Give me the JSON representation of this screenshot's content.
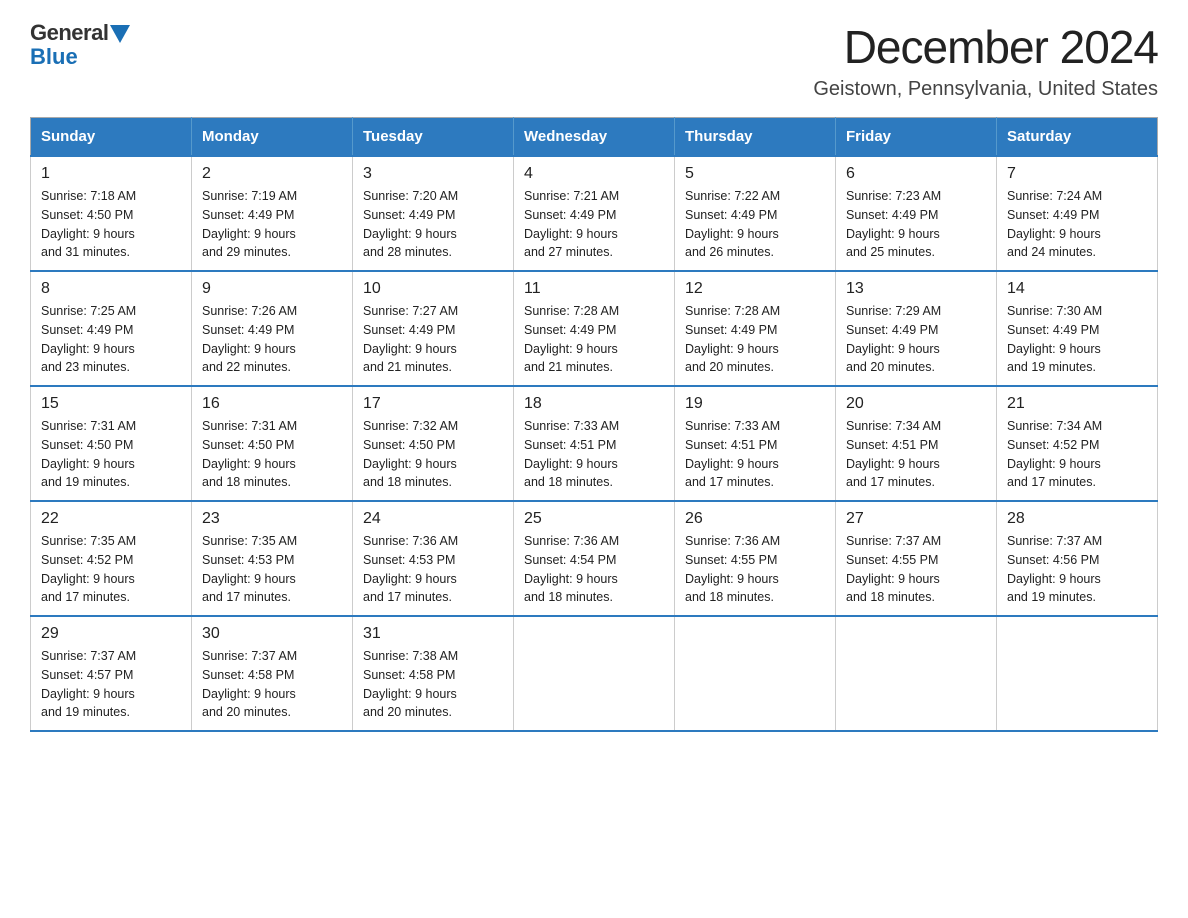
{
  "logo": {
    "general": "General",
    "blue": "Blue"
  },
  "title": "December 2024",
  "subtitle": "Geistown, Pennsylvania, United States",
  "headers": [
    "Sunday",
    "Monday",
    "Tuesday",
    "Wednesday",
    "Thursday",
    "Friday",
    "Saturday"
  ],
  "weeks": [
    [
      {
        "day": "1",
        "sunrise": "7:18 AM",
        "sunset": "4:50 PM",
        "daylight": "9 hours and 31 minutes."
      },
      {
        "day": "2",
        "sunrise": "7:19 AM",
        "sunset": "4:49 PM",
        "daylight": "9 hours and 29 minutes."
      },
      {
        "day": "3",
        "sunrise": "7:20 AM",
        "sunset": "4:49 PM",
        "daylight": "9 hours and 28 minutes."
      },
      {
        "day": "4",
        "sunrise": "7:21 AM",
        "sunset": "4:49 PM",
        "daylight": "9 hours and 27 minutes."
      },
      {
        "day": "5",
        "sunrise": "7:22 AM",
        "sunset": "4:49 PM",
        "daylight": "9 hours and 26 minutes."
      },
      {
        "day": "6",
        "sunrise": "7:23 AM",
        "sunset": "4:49 PM",
        "daylight": "9 hours and 25 minutes."
      },
      {
        "day": "7",
        "sunrise": "7:24 AM",
        "sunset": "4:49 PM",
        "daylight": "9 hours and 24 minutes."
      }
    ],
    [
      {
        "day": "8",
        "sunrise": "7:25 AM",
        "sunset": "4:49 PM",
        "daylight": "9 hours and 23 minutes."
      },
      {
        "day": "9",
        "sunrise": "7:26 AM",
        "sunset": "4:49 PM",
        "daylight": "9 hours and 22 minutes."
      },
      {
        "day": "10",
        "sunrise": "7:27 AM",
        "sunset": "4:49 PM",
        "daylight": "9 hours and 21 minutes."
      },
      {
        "day": "11",
        "sunrise": "7:28 AM",
        "sunset": "4:49 PM",
        "daylight": "9 hours and 21 minutes."
      },
      {
        "day": "12",
        "sunrise": "7:28 AM",
        "sunset": "4:49 PM",
        "daylight": "9 hours and 20 minutes."
      },
      {
        "day": "13",
        "sunrise": "7:29 AM",
        "sunset": "4:49 PM",
        "daylight": "9 hours and 20 minutes."
      },
      {
        "day": "14",
        "sunrise": "7:30 AM",
        "sunset": "4:49 PM",
        "daylight": "9 hours and 19 minutes."
      }
    ],
    [
      {
        "day": "15",
        "sunrise": "7:31 AM",
        "sunset": "4:50 PM",
        "daylight": "9 hours and 19 minutes."
      },
      {
        "day": "16",
        "sunrise": "7:31 AM",
        "sunset": "4:50 PM",
        "daylight": "9 hours and 18 minutes."
      },
      {
        "day": "17",
        "sunrise": "7:32 AM",
        "sunset": "4:50 PM",
        "daylight": "9 hours and 18 minutes."
      },
      {
        "day": "18",
        "sunrise": "7:33 AM",
        "sunset": "4:51 PM",
        "daylight": "9 hours and 18 minutes."
      },
      {
        "day": "19",
        "sunrise": "7:33 AM",
        "sunset": "4:51 PM",
        "daylight": "9 hours and 17 minutes."
      },
      {
        "day": "20",
        "sunrise": "7:34 AM",
        "sunset": "4:51 PM",
        "daylight": "9 hours and 17 minutes."
      },
      {
        "day": "21",
        "sunrise": "7:34 AM",
        "sunset": "4:52 PM",
        "daylight": "9 hours and 17 minutes."
      }
    ],
    [
      {
        "day": "22",
        "sunrise": "7:35 AM",
        "sunset": "4:52 PM",
        "daylight": "9 hours and 17 minutes."
      },
      {
        "day": "23",
        "sunrise": "7:35 AM",
        "sunset": "4:53 PM",
        "daylight": "9 hours and 17 minutes."
      },
      {
        "day": "24",
        "sunrise": "7:36 AM",
        "sunset": "4:53 PM",
        "daylight": "9 hours and 17 minutes."
      },
      {
        "day": "25",
        "sunrise": "7:36 AM",
        "sunset": "4:54 PM",
        "daylight": "9 hours and 18 minutes."
      },
      {
        "day": "26",
        "sunrise": "7:36 AM",
        "sunset": "4:55 PM",
        "daylight": "9 hours and 18 minutes."
      },
      {
        "day": "27",
        "sunrise": "7:37 AM",
        "sunset": "4:55 PM",
        "daylight": "9 hours and 18 minutes."
      },
      {
        "day": "28",
        "sunrise": "7:37 AM",
        "sunset": "4:56 PM",
        "daylight": "9 hours and 19 minutes."
      }
    ],
    [
      {
        "day": "29",
        "sunrise": "7:37 AM",
        "sunset": "4:57 PM",
        "daylight": "9 hours and 19 minutes."
      },
      {
        "day": "30",
        "sunrise": "7:37 AM",
        "sunset": "4:58 PM",
        "daylight": "9 hours and 20 minutes."
      },
      {
        "day": "31",
        "sunrise": "7:38 AM",
        "sunset": "4:58 PM",
        "daylight": "9 hours and 20 minutes."
      },
      null,
      null,
      null,
      null
    ]
  ],
  "labels": {
    "sunrise": "Sunrise:",
    "sunset": "Sunset:",
    "daylight": "Daylight:"
  }
}
